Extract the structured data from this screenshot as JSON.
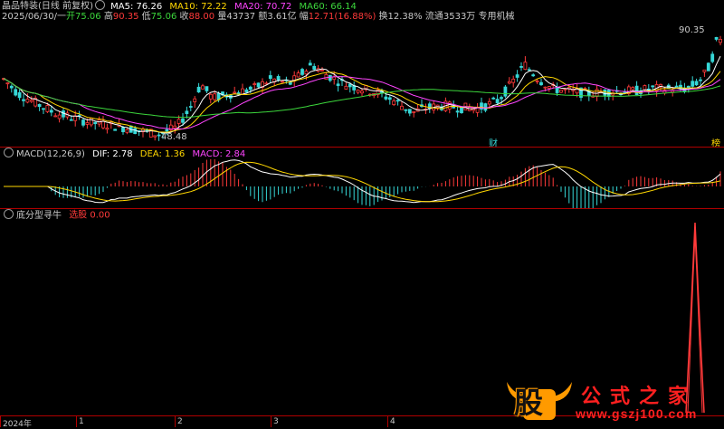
{
  "header": {
    "stock_name": "晶品特装(日线 前复权)",
    "ma": [
      {
        "label": "MA5: 76.26",
        "color": "#ffffff"
      },
      {
        "label": "MA10: 72.22",
        "color": "#ffd700"
      },
      {
        "label": "MA20: 70.72",
        "color": "#ff45ff"
      },
      {
        "label": "MA60: 66.14",
        "color": "#3cd73c"
      }
    ],
    "quote": {
      "date": "2025/06/30/一",
      "open_label": "开",
      "open": "75.06",
      "high_label": "高",
      "high": "90.35",
      "low_label": "低",
      "low": "75.06",
      "close_label": "收",
      "close": "88.00",
      "volume_label": "量",
      "volume": "43737",
      "amount_label": "额",
      "amount": "3.61亿",
      "change_label": "幅",
      "change": "12.71(16.88%)",
      "turnover": "换12.38%",
      "float": "流通3533万",
      "sector": "专用机械"
    }
  },
  "main_chart": {
    "high_marker": "90.35",
    "low_marker": "48.48",
    "finance_badge_1": "财",
    "finance_badge_2": "榜"
  },
  "macd": {
    "title": "MACD(12,26,9)",
    "dif": "DIF: 2.78",
    "dea": "DEA: 1.36",
    "macd": "MACD: 2.84"
  },
  "indicator": {
    "title": "底分型寻牛",
    "signal_label": "选股",
    "signal_value": "0.00"
  },
  "axis": {
    "ticks": [
      "2024年",
      "1",
      "2",
      "3",
      "4"
    ]
  },
  "watermark": {
    "logo_char": "股",
    "name": "公式之家",
    "url": "www.gszj100.com"
  },
  "colors": {
    "up": "#ff3a3a",
    "down": "#36d7d7",
    "divider": "#b00000",
    "ma5": "#ffffff",
    "ma10": "#ffd700",
    "ma20": "#ff45ff",
    "ma60": "#3cd73c"
  }
}
